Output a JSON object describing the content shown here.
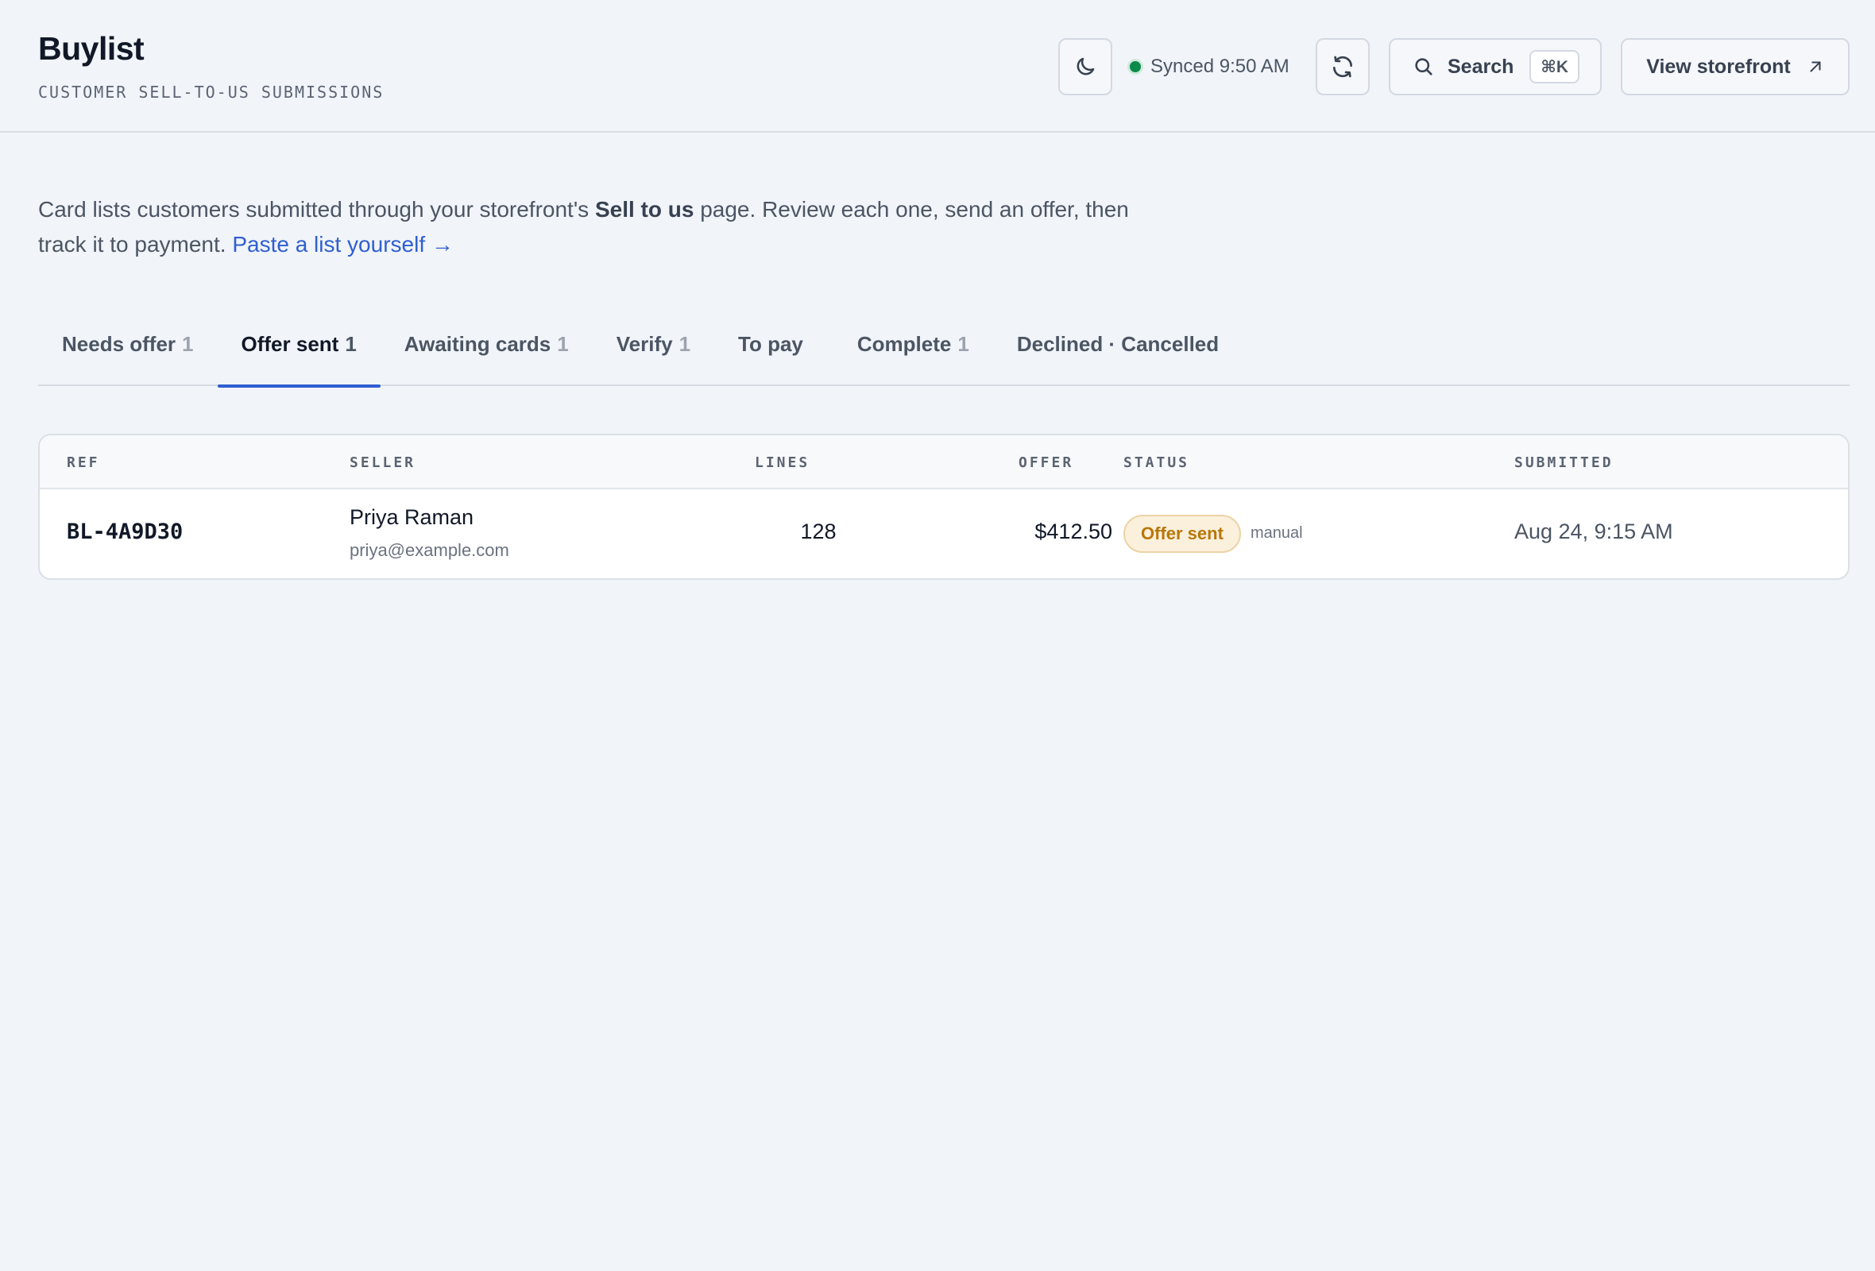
{
  "header": {
    "title": "Buylist",
    "subtitle": "CUSTOMER SELL-TO-US SUBMISSIONS",
    "sync_status": "Synced 9:50 AM",
    "search_label": "Search",
    "search_shortcut": "⌘K",
    "storefront_label": "View storefront",
    "colors": {
      "sync_dot": "#0b8a4a"
    }
  },
  "intro": {
    "text_before": "Card lists customers submitted through your storefront's ",
    "emphasis": "Sell to us",
    "text_after": " page. Review each one, send an offer, then track it to payment. ",
    "link_label": "Paste a list yourself →"
  },
  "tabs": [
    {
      "label": "Needs offer",
      "count": "1"
    },
    {
      "label": "Offer sent",
      "count": "1",
      "active": true
    },
    {
      "label": "Awaiting cards",
      "count": "1"
    },
    {
      "label": "Verify",
      "count": "1"
    },
    {
      "label": "To pay",
      "count": ""
    },
    {
      "label": "Complete",
      "count": "1"
    },
    {
      "label": "Declined · Cancelled",
      "count": ""
    }
  ],
  "table": {
    "columns": [
      "REF",
      "SELLER",
      "LINES",
      "OFFER",
      "STATUS",
      "SUBMITTED"
    ],
    "rows": [
      {
        "ref": "BL-4A9D30",
        "seller_name": "Priya Raman",
        "seller_email": "priya@example.com",
        "lines": "128",
        "offer": "$412.50",
        "status": "Offer sent",
        "status_note": "manual",
        "submitted": "Aug 24, 9:15 AM"
      }
    ]
  },
  "icons": {
    "theme": "moon-icon",
    "refresh": "refresh-icon",
    "search": "search-icon",
    "external": "arrow-up-right-icon"
  },
  "colors": {
    "accent": "#2f5fd0",
    "badge_bg": "#fbf0dc",
    "badge_text": "#b8770a",
    "background": "#f1f4f9"
  }
}
